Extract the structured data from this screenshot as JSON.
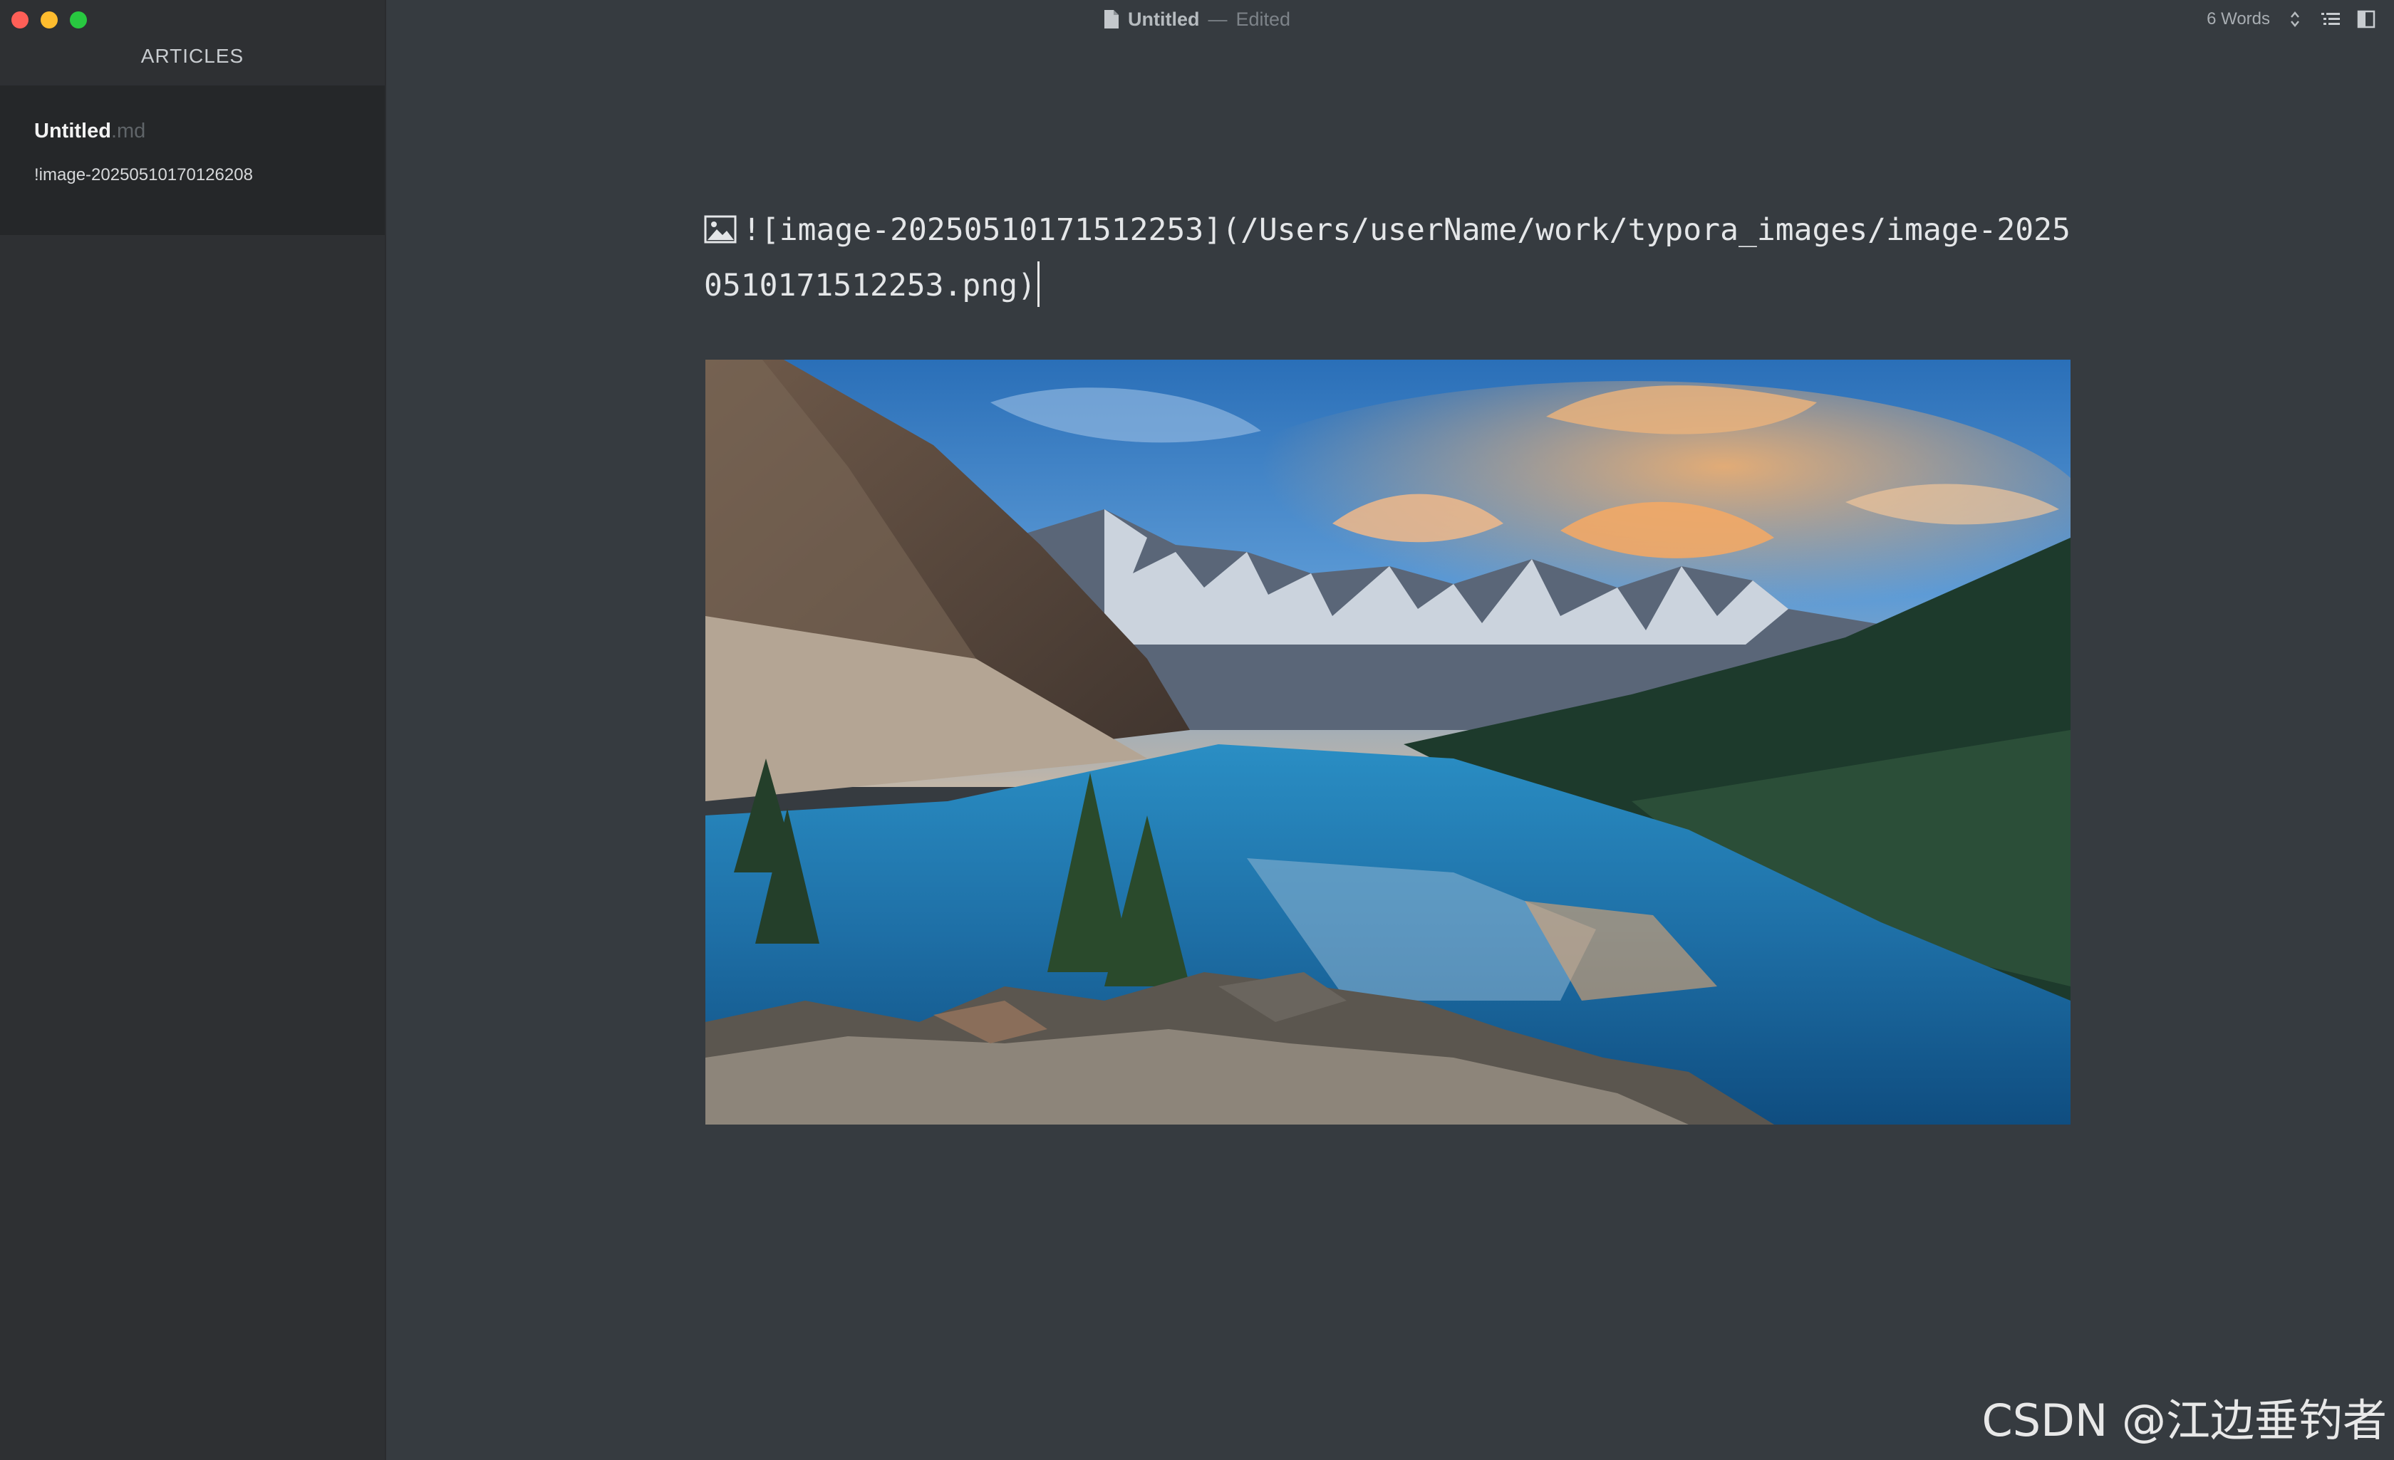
{
  "window": {
    "title": "Untitled",
    "title_separator": "—",
    "title_status": "Edited",
    "word_count": "6 Words"
  },
  "sidebar": {
    "header": "ARTICLES",
    "files": [
      {
        "name": "Untitled",
        "ext": ".md",
        "snippet": "!image-20250510170126208"
      }
    ]
  },
  "editor": {
    "markdown_source": "![image-20250510171512253](/Users/userName/work/typora_images/image-20250510171512253.png)"
  },
  "watermark": "CSDN @江边垂钓者",
  "icons": [
    "image-icon",
    "document-icon",
    "outline-icon",
    "sidebar-toggle-icon",
    "chevron-updown-icon"
  ]
}
